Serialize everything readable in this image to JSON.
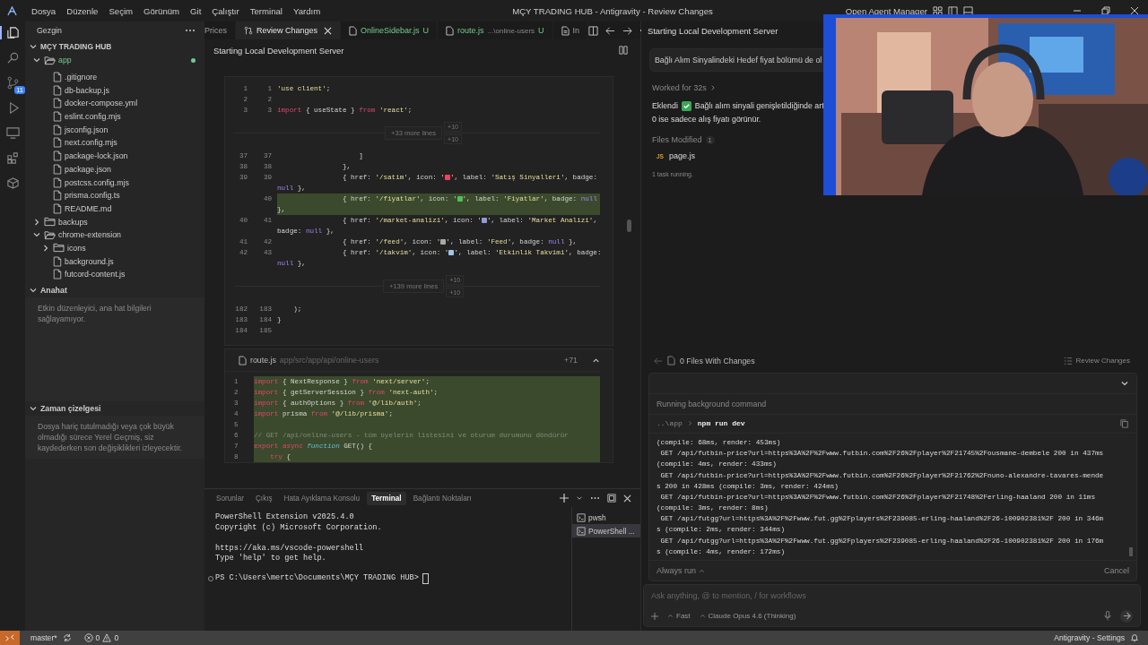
{
  "title_bar": {
    "menu": [
      "Dosya",
      "Düzenle",
      "Seçim",
      "Görünüm",
      "Git",
      "Çalıştır",
      "Terminal",
      "Yardım"
    ],
    "title": "MÇY TRADING HUB - Antigravity - Review Changes",
    "agent_manager": "Open Agent Manager"
  },
  "activity_bar": [
    {
      "kind": "files",
      "selected": true
    },
    {
      "kind": "search",
      "selected": false
    },
    {
      "kind": "source-control",
      "selected": false,
      "badge": "11"
    },
    {
      "kind": "run",
      "selected": false
    },
    {
      "kind": "remote",
      "selected": false
    },
    {
      "kind": "extensions",
      "selected": false
    },
    {
      "kind": "box",
      "selected": false
    }
  ],
  "explorer": {
    "title": "Gezgin",
    "root": "MÇY TRADING HUB",
    "tree": [
      {
        "label": "app",
        "kind": "folder",
        "expanded": true,
        "modified": true,
        "children": [
          {
            "label": ".gitignore",
            "kind": "file",
            "modified": false
          },
          {
            "label": "db-backup.js",
            "kind": "file",
            "modified": false
          },
          {
            "label": "docker-compose.yml",
            "kind": "file",
            "modified": false
          },
          {
            "label": "eslint.config.mjs",
            "kind": "file",
            "modified": false
          },
          {
            "label": "jsconfig.json",
            "kind": "file",
            "modified": false
          },
          {
            "label": "next.config.mjs",
            "kind": "file",
            "modified": false
          },
          {
            "label": "package-lock.json",
            "kind": "file",
            "modified": false
          },
          {
            "label": "package.json",
            "kind": "file",
            "modified": false
          },
          {
            "label": "postcss.config.mjs",
            "kind": "file",
            "modified": false
          },
          {
            "label": "prisma.config.ts",
            "kind": "file",
            "modified": false
          },
          {
            "label": "README.md",
            "kind": "file",
            "modified": false
          }
        ]
      },
      {
        "label": "backups",
        "kind": "folder",
        "expanded": false,
        "modified": false
      },
      {
        "label": "chrome-extension",
        "kind": "folder",
        "expanded": true,
        "modified": false,
        "children": [
          {
            "label": "icons",
            "kind": "folder",
            "expanded": false,
            "modified": false
          },
          {
            "label": "background.js",
            "kind": "file",
            "modified": false
          },
          {
            "label": "futcord-content.js",
            "kind": "file",
            "modified": false
          }
        ]
      }
    ]
  },
  "outline": {
    "title": "Anahat",
    "expanded": true,
    "message": "Etkin düzenleyici, ana hat bilgileri sağlayamıyor."
  },
  "timeline": {
    "title": "Zaman çizelgesi",
    "expanded": true,
    "message": "Dosya hariç tutulmadığı veya çok büyük olmadığı sürece Yerel Geçmiş, siz kaydederken son değişiklikleri izleyecektir."
  },
  "editor": {
    "tabs": [
      {
        "label": "Prices",
        "kind": "file",
        "selected": false
      },
      {
        "label": "Review Changes",
        "kind": "review",
        "selected": true
      },
      {
        "label": "OnlineSidebar.js",
        "kind": "file",
        "selected": false,
        "status": "U"
      },
      {
        "label": "route.js",
        "kind": "file",
        "selected": false,
        "path": "...\\online-users",
        "status": "U"
      },
      {
        "label": "In",
        "kind": "preview",
        "selected": false
      }
    ],
    "header": "Starting Local Development Server",
    "diff": [
      {
        "kind": "line",
        "old": "1",
        "new": "1",
        "added": false,
        "parts": [
          {
            "kind": "str",
            "text": "'use client'"
          },
          {
            "kind": "plain",
            "text": ";"
          }
        ]
      },
      {
        "kind": "line",
        "old": "2",
        "new": "2",
        "added": false
      },
      {
        "kind": "line",
        "old": "3",
        "new": "3",
        "added": false,
        "parts": [
          {
            "kind": "kw",
            "text": "import"
          },
          {
            "kind": "plain",
            "text": " { useState } "
          },
          {
            "kind": "kw",
            "text": "from"
          },
          {
            "kind": "str",
            "text": " 'react'"
          },
          {
            "kind": "plain",
            "text": ";"
          }
        ]
      },
      {
        "kind": "expander",
        "label": "+33 more lines",
        "up": "+10",
        "down": "+10"
      },
      {
        "kind": "line",
        "old": "37",
        "new": "37",
        "added": false,
        "parts": [
          {
            "kind": "plain",
            "text": "                    ]"
          }
        ]
      },
      {
        "kind": "line",
        "old": "38",
        "new": "38",
        "added": false,
        "parts": [
          {
            "kind": "plain",
            "text": "                },"
          }
        ]
      },
      {
        "kind": "line",
        "old": "39",
        "new": "39",
        "added": false,
        "parts": [
          {
            "kind": "plain",
            "text": "                { href: "
          },
          {
            "kind": "str",
            "text": "'/satim'"
          },
          {
            "kind": "plain",
            "text": ", icon: "
          },
          {
            "kind": "str",
            "text": "'"
          },
          {
            "kind": "emoji",
            "color": "#e8455e"
          },
          {
            "kind": "str",
            "text": "'"
          },
          {
            "kind": "plain",
            "text": ", label: "
          },
          {
            "kind": "str",
            "text": "'Satış Sinyalleri'"
          },
          {
            "kind": "plain",
            "text": ", badge:"
          }
        ]
      },
      {
        "kind": "line",
        "added": false,
        "parts": [
          {
            "kind": "null",
            "text": "null"
          },
          {
            "kind": "plain",
            "text": " },"
          }
        ]
      },
      {
        "kind": "line",
        "new": "40",
        "added": true,
        "parts": [
          {
            "kind": "plain",
            "text": "                { href: "
          },
          {
            "kind": "str",
            "text": "'/fiyatlar'"
          },
          {
            "kind": "plain",
            "text": ", icon: "
          },
          {
            "kind": "str",
            "text": "'"
          },
          {
            "kind": "emoji",
            "color": "#4fbf5a"
          },
          {
            "kind": "str",
            "text": "'"
          },
          {
            "kind": "plain",
            "text": ", label: "
          },
          {
            "kind": "str",
            "text": "'Fiyatlar'"
          },
          {
            "kind": "plain",
            "text": ", badge: "
          },
          {
            "kind": "null",
            "text": "null"
          }
        ]
      },
      {
        "kind": "line",
        "added": true,
        "parts": [
          {
            "kind": "plain",
            "text": "},"
          }
        ]
      },
      {
        "kind": "line",
        "old": "40",
        "new": "41",
        "added": false,
        "parts": [
          {
            "kind": "plain",
            "text": "                { href: "
          },
          {
            "kind": "str",
            "text": "'/market-analizi'"
          },
          {
            "kind": "plain",
            "text": ", icon: "
          },
          {
            "kind": "str",
            "text": "'"
          },
          {
            "kind": "emoji",
            "color": "#8f9bd8"
          },
          {
            "kind": "str",
            "text": "'"
          },
          {
            "kind": "plain",
            "text": ", label: "
          },
          {
            "kind": "str",
            "text": "'Market Analizi'"
          },
          {
            "kind": "plain",
            "text": ","
          }
        ]
      },
      {
        "kind": "line",
        "added": false,
        "parts": [
          {
            "kind": "plain",
            "text": "badge: "
          },
          {
            "kind": "null",
            "text": "null"
          },
          {
            "kind": "plain",
            "text": " },"
          }
        ]
      },
      {
        "kind": "line",
        "old": "41",
        "new": "42",
        "added": false,
        "parts": [
          {
            "kind": "plain",
            "text": "                { href: "
          },
          {
            "kind": "str",
            "text": "'/feed'"
          },
          {
            "kind": "plain",
            "text": ", icon: "
          },
          {
            "kind": "str",
            "text": "'"
          },
          {
            "kind": "emoji",
            "color": "#a9a9a9"
          },
          {
            "kind": "str",
            "text": "'"
          },
          {
            "kind": "plain",
            "text": ", label: "
          },
          {
            "kind": "str",
            "text": "'Feed'"
          },
          {
            "kind": "plain",
            "text": ", badge: "
          },
          {
            "kind": "null",
            "text": "null"
          },
          {
            "kind": "plain",
            "text": " },"
          }
        ]
      },
      {
        "kind": "line",
        "old": "42",
        "new": "43",
        "added": false,
        "parts": [
          {
            "kind": "plain",
            "text": "                { href: "
          },
          {
            "kind": "str",
            "text": "'/takvim'"
          },
          {
            "kind": "plain",
            "text": ", icon: "
          },
          {
            "kind": "str",
            "text": "'"
          },
          {
            "kind": "emoji",
            "color": "#9fc4ef"
          },
          {
            "kind": "str",
            "text": "'"
          },
          {
            "kind": "plain",
            "text": ", label: "
          },
          {
            "kind": "str",
            "text": "'Etkinlik Takvimi'"
          },
          {
            "kind": "plain",
            "text": ", badge:"
          }
        ]
      },
      {
        "kind": "line",
        "added": false,
        "parts": [
          {
            "kind": "null",
            "text": "null"
          },
          {
            "kind": "plain",
            "text": " },"
          }
        ]
      },
      {
        "kind": "expander",
        "label": "+139 more lines",
        "up": "+10",
        "down": "+10"
      },
      {
        "kind": "line",
        "old": "182",
        "new": "183",
        "added": false,
        "parts": [
          {
            "kind": "plain",
            "text": "    );"
          }
        ]
      },
      {
        "kind": "line",
        "old": "183",
        "new": "184",
        "added": false,
        "parts": [
          {
            "kind": "plain",
            "text": "}"
          }
        ]
      },
      {
        "kind": "line",
        "old": "184",
        "new": "185",
        "added": false
      }
    ],
    "route_file": {
      "name": "route.js",
      "path": "app/src/app/api/online-users",
      "count": "+71",
      "expanded": true,
      "rows": [
        {
          "new": "1",
          "added": true,
          "parts": [
            {
              "kind": "kw",
              "text": "import"
            },
            {
              "kind": "plain",
              "text": " { NextResponse } "
            },
            {
              "kind": "kw",
              "text": "from"
            },
            {
              "kind": "str",
              "text": " 'next/server'"
            },
            {
              "kind": "plain",
              "text": ";"
            }
          ]
        },
        {
          "new": "2",
          "added": true,
          "parts": [
            {
              "kind": "kw",
              "text": "import"
            },
            {
              "kind": "plain",
              "text": " { getServerSession } "
            },
            {
              "kind": "kw",
              "text": "from"
            },
            {
              "kind": "str",
              "text": " 'next-auth'"
            },
            {
              "kind": "plain",
              "text": ";"
            }
          ]
        },
        {
          "new": "3",
          "added": true,
          "parts": [
            {
              "kind": "kw",
              "text": "import"
            },
            {
              "kind": "plain",
              "text": " { authOptions } "
            },
            {
              "kind": "kw",
              "text": "from"
            },
            {
              "kind": "str",
              "text": " '@/lib/auth'"
            },
            {
              "kind": "plain",
              "text": ";"
            }
          ]
        },
        {
          "new": "4",
          "added": true,
          "parts": [
            {
              "kind": "kw",
              "text": "import"
            },
            {
              "kind": "plain",
              "text": " prisma "
            },
            {
              "kind": "kw",
              "text": "from"
            },
            {
              "kind": "str",
              "text": " '@/lib/prisma'"
            },
            {
              "kind": "plain",
              "text": ";"
            }
          ]
        },
        {
          "new": "5",
          "added": true
        },
        {
          "new": "6",
          "added": true,
          "parts": [
            {
              "kind": "comment",
              "text": "// GET /api/online-users - tüm üyelerin listesini ve oturum durumunu döndürür"
            }
          ]
        },
        {
          "new": "7",
          "added": true,
          "parts": [
            {
              "kind": "kw",
              "text": "export async"
            },
            {
              "kind": "fn",
              "text": " function"
            },
            {
              "kind": "plain",
              "text": " GET() {"
            }
          ]
        },
        {
          "new": "8",
          "added": true,
          "parts": [
            {
              "kind": "kw",
              "text": "    try"
            },
            {
              "kind": "plain",
              "text": " {"
            }
          ]
        }
      ]
    }
  },
  "panel": {
    "tabs": [
      {
        "label": "Sorunlar",
        "selected": false
      },
      {
        "label": "Çıkış",
        "selected": false
      },
      {
        "label": "Hata Ayıklama Konsolu",
        "selected": false
      },
      {
        "label": "Terminal",
        "selected": true
      },
      {
        "label": "Bağlantı Noktaları",
        "selected": false
      }
    ],
    "blocks": [
      [
        "PowerShell Extension v2025.4.0",
        "Copyright (c) Microsoft Corporation."
      ],
      [
        "https://aka.ms/vscode-powershell",
        "Type 'help' to get help."
      ]
    ],
    "prompt": "PS C:\\Users\\mertc\\Documents\\MÇY TRADING HUB>",
    "terminals": [
      {
        "label": "pwsh",
        "selected": false
      },
      {
        "label": "PowerShell ...",
        "selected": true
      }
    ]
  },
  "agent": {
    "header": "Starting Local Development Server",
    "request": "Bağlı Alım Sinyalindeki Hedef fiyat bölümü de ol",
    "worked": "Worked for 32s",
    "reply_lead": "Eklendi",
    "reply_line1": "Bağlı alım sinyali genişletildiğinde art",
    "reply_line2": "0 ise sadece alış fiyatı görünür.",
    "files_title": "Files Modified",
    "files_count": "1",
    "files": [
      {
        "badge": "JS",
        "name": "page.js"
      }
    ],
    "tasks": "1 task running.",
    "changes": "0 Files With Changes",
    "review": "Review Changes",
    "command": {
      "expanded": true,
      "title": "Running background command",
      "cwd": "..\\app",
      "cmd": "npm run dev",
      "output": [
        "(compile: 68ms, render: 453ms)",
        " GET /api/futbin-price?url=https%3A%2F%2Fwww.futbin.com%2F26%2Fplayer%2F21745%2Fousmane-dembele 200 in 437ms",
        "(compile: 4ms, render: 433ms)",
        " GET /api/futbin-price?url=https%3A%2F%2Fwww.futbin.com%2F26%2Fplayer%2F21762%2Fnuno-alexandre-tavares-mende",
        "s 200 in 428ms (compile: 3ms, render: 424ms)",
        " GET /api/futbin-price?url=https%3A%2F%2Fwww.futbin.com%2F26%2Fplayer%2F21748%2Ferling-haaland 200 in 11ms",
        "(compile: 3ms, render: 8ms)",
        " GET /api/futgg?url=https%3A%2F%2Fwww.fut.gg%2Fplayers%2F239085-erling-haaland%2F26-100902381%2F 200 in 346m",
        "s (compile: 2ms, render: 344ms)",
        " GET /api/futgg?url=https%3A%2F%2Fwww.fut.gg%2Fplayers%2F239085-erling-haaland%2F26-100902381%2F 200 in 176m",
        "s (compile: 4ms, render: 172ms)"
      ],
      "always_run": "Always run",
      "cancel": "Cancel"
    },
    "input": {
      "placeholder": "Ask anything, @ to mention, / for workflows",
      "mode": "Fast",
      "model": "Claude Opus 4.6 (Thinking)"
    }
  },
  "status_bar": {
    "branch": "master*",
    "errors": "0",
    "warnings": "0",
    "right": "Antigravity - Settings"
  }
}
